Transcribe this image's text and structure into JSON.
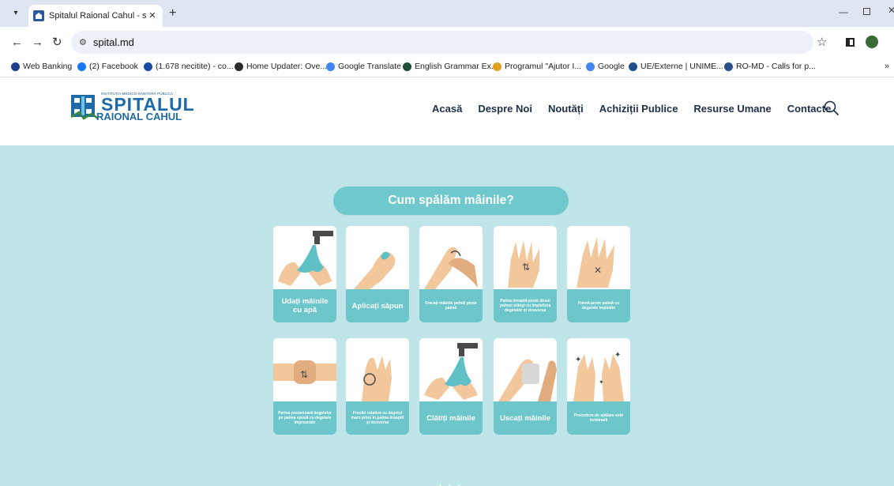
{
  "browser": {
    "tab_title": "Spitalul Raional Cahul - spital.m",
    "new_tab": "+",
    "url": "spital.md",
    "bookmarks": [
      {
        "label": "Web Banking",
        "color": "#1d3f8c"
      },
      {
        "label": "(2) Facebook",
        "color": "#1877f2"
      },
      {
        "label": "(1.678 necitite) - co...",
        "color": "#1a4da1"
      },
      {
        "label": "Home Updater: Ove...",
        "color": "#2b2b2b"
      },
      {
        "label": "Google Translate",
        "color": "#4285f4"
      },
      {
        "label": "English Grammar Ex...",
        "color": "#1c4f3a"
      },
      {
        "label": "Programul \"Ajutor I...",
        "color": "#e0a020"
      },
      {
        "label": "Google",
        "color": "#4285f4"
      },
      {
        "label": "UE/Externe | UNIME...",
        "color": "#1e4e8c"
      },
      {
        "label": "RO-MD - Calls for p...",
        "color": "#2d4f8a"
      }
    ],
    "more": "»"
  },
  "site": {
    "logo": {
      "small": "INSTITUȚIA MEDICO-SANITARĂ PUBLICĂ",
      "main": "SPITALUL",
      "sub": "RAIONAL CAHUL"
    },
    "nav": [
      "Acasă",
      "Despre Noi",
      "Noutăți",
      "Achiziții Publice",
      "Resurse Umane",
      "Contacte"
    ]
  },
  "poster": {
    "title": "Cum spălăm mâinile?",
    "steps": [
      {
        "label": "Udați mâinile cu apă",
        "size": "big"
      },
      {
        "label": "Aplicați săpun",
        "size": "big"
      },
      {
        "label": "Frecați mâinile palmă peste palmă",
        "size": "small"
      },
      {
        "label": "Palma dreaptă peste dosul palmei stângi cu împletirea degetelor și viceversa",
        "size": "small"
      },
      {
        "label": "Palmă peste palmă cu degetele împletite",
        "size": "small"
      },
      {
        "label": "Partea posterioară degetelor pe palma opusă cu degetele împreunate",
        "size": "small"
      },
      {
        "label": "Frecări rotative cu degetul mare prins în palma dreaptă și viceversa",
        "size": "small"
      },
      {
        "label": "Clătiți mâinile",
        "size": "big"
      },
      {
        "label": "Uscați mâinile",
        "size": "big"
      },
      {
        "label": "Procedura de spălare este terminată",
        "size": "small"
      }
    ]
  }
}
